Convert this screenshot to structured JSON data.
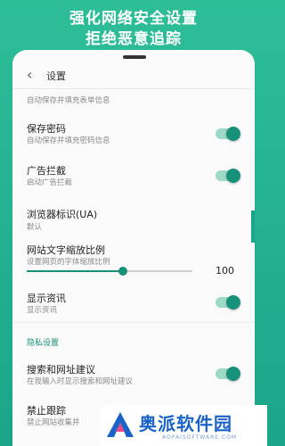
{
  "hero": {
    "line1": "强化网络安全设置",
    "line2": "拒绝恶意追踪"
  },
  "appbar": {
    "back_icon": "‹",
    "title": "设置"
  },
  "settings": [
    {
      "subtitle": "自动保存并填充表单信息"
    },
    {
      "title": "保存密码",
      "subtitle": "自动保存并填充密码信息",
      "on": true
    },
    {
      "title": "广告拦截",
      "subtitle": "启动广告拦截",
      "on": true
    },
    {
      "title": "浏览器标识(UA)",
      "subtitle": "默认"
    },
    {
      "title": "网站文字缩放比例",
      "subtitle": "设置网页的字体缩放比例",
      "value": "100"
    },
    {
      "title": "显示资讯",
      "subtitle": "显示资讯",
      "on": true
    }
  ],
  "privacy_section": "隐私设置",
  "privacy": [
    {
      "title": "搜索和网址建议",
      "subtitle": "在我输入时显示搜索和网址建议",
      "on": true
    },
    {
      "title": "禁止跟踪",
      "subtitle": "禁止网站收集并"
    }
  ],
  "slider_fraction": 0.58,
  "brand": {
    "name": "奥派软件园",
    "url": "AOPAISOFTWARE.COM"
  },
  "colors": {
    "accent": "#17917a",
    "background": "#2dbe98",
    "brand": "#1b63c9"
  }
}
